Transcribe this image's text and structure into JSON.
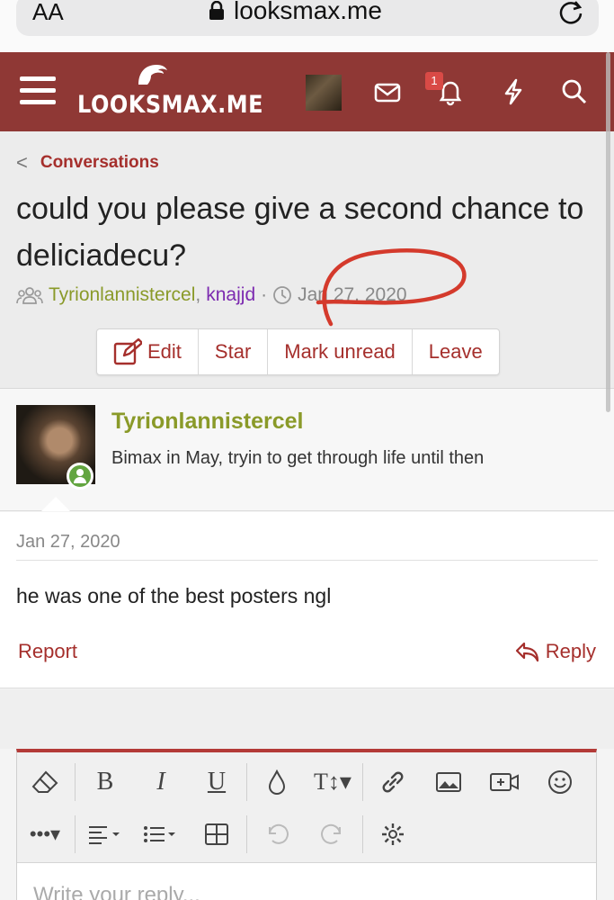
{
  "browser": {
    "aa_label": "AA",
    "url": "looksmax.me"
  },
  "header": {
    "logo_text": "LOOKSMAX.ME",
    "notification_count": "1"
  },
  "breadcrumb": {
    "label": "Conversations"
  },
  "conversation": {
    "title": "could you please give a second chance to deliciadecu?",
    "participant_1": "Tyrionlannistercel",
    "separator_comma": ",",
    "participant_2": "knajjd",
    "dot": "·",
    "date": "Jan 27, 2020"
  },
  "actions": {
    "edit": "Edit",
    "star": "Star",
    "mark_unread": "Mark unread",
    "leave": "Leave"
  },
  "message": {
    "username": "Tyrionlannistercel",
    "user_title": "Bimax in May, tryin to get through life until then",
    "date": "Jan 27, 2020",
    "body": "he was one of the best posters ngl",
    "report_label": "Report",
    "reply_label": "Reply"
  },
  "editor": {
    "placeholder": "Write your reply..."
  },
  "colors": {
    "brand": "#8f3835",
    "link": "#a52f2c",
    "username": "#8a9a29",
    "participant_2": "#7c2ab0",
    "annotation": "#d43a2c"
  }
}
